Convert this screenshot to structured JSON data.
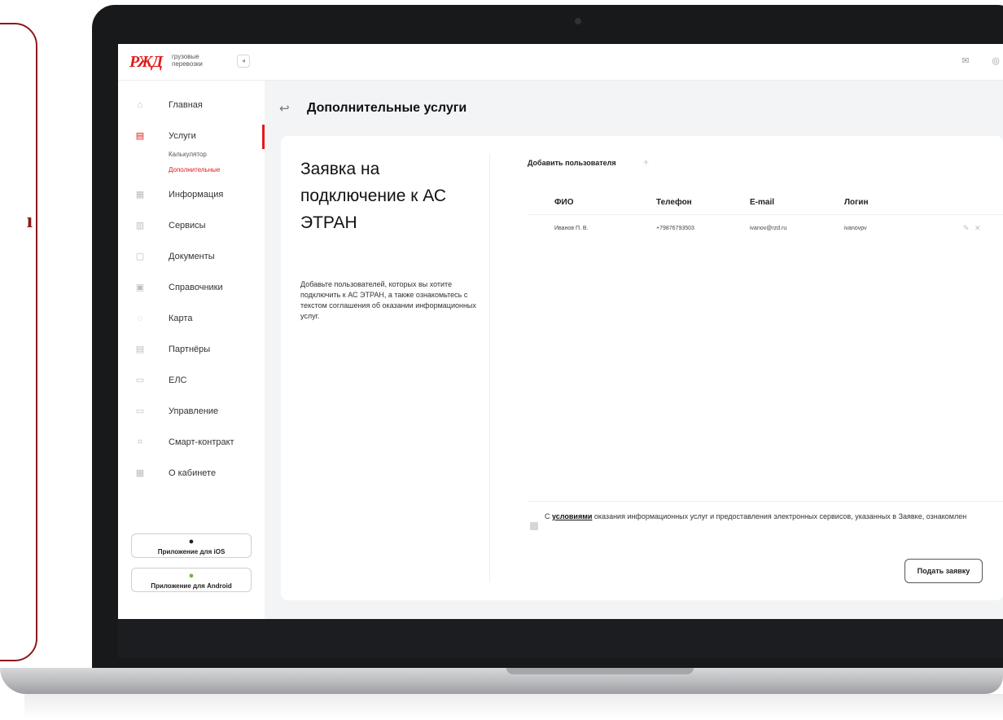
{
  "logo": {
    "text": "РЖД",
    "subtitle": "грузовые перевозки"
  },
  "side_card": {
    "glyph": "ı"
  },
  "sidebar": {
    "items": [
      {
        "label": "Главная",
        "icon": "home-icon"
      },
      {
        "label": "Услуги",
        "icon": "services-icon",
        "active": true
      },
      {
        "label": "Информация",
        "icon": "info-icon"
      },
      {
        "label": "Сервисы",
        "icon": "grid-icon"
      },
      {
        "label": "Документы",
        "icon": "document-icon"
      },
      {
        "label": "Справочники",
        "icon": "book-icon"
      },
      {
        "label": "Карта",
        "icon": "map-pin-icon"
      },
      {
        "label": "Партнёры",
        "icon": "partners-icon"
      },
      {
        "label": "ЕЛС",
        "icon": "wallet-icon"
      },
      {
        "label": "Управление",
        "icon": "monitor-icon"
      },
      {
        "label": "Смарт-контракт",
        "icon": "contract-icon"
      },
      {
        "label": "О кабинете",
        "icon": "about-icon"
      }
    ],
    "sub_items": [
      {
        "label": "Калькулятор"
      },
      {
        "label": "Дополнительные",
        "current": true
      }
    ],
    "apps": {
      "ios": "Приложение для iOS",
      "android": "Приложение для Android"
    }
  },
  "page": {
    "title": "Дополнительные услуги"
  },
  "request": {
    "title": "Заявка на подключение к АС ЭТРАН",
    "description": "Добавьте пользователей, которых вы хотите подключить к АС ЭТРАН, а также ознакомьтесь с текстом соглашения об оказании информационных услуг."
  },
  "users": {
    "add_label": "Добавить пользователя",
    "add_symbol": "+",
    "columns": [
      "ФИО",
      "Телефон",
      "E-mail",
      "Логин"
    ],
    "rows": [
      [
        "Иванов П. В.",
        "+79876793503",
        "ivanov@rzd.ru",
        "ivanovpv"
      ]
    ]
  },
  "agreement": {
    "prefix": "С ",
    "link": "условиями",
    "text": " оказания информационных услуг и предоставления электронных сервисов, указанных в Заявке, ознакомлен"
  },
  "submit_label": "Подать заявку",
  "colors": {
    "accent": "#e21a1a",
    "side_border": "#8b1a1a"
  }
}
